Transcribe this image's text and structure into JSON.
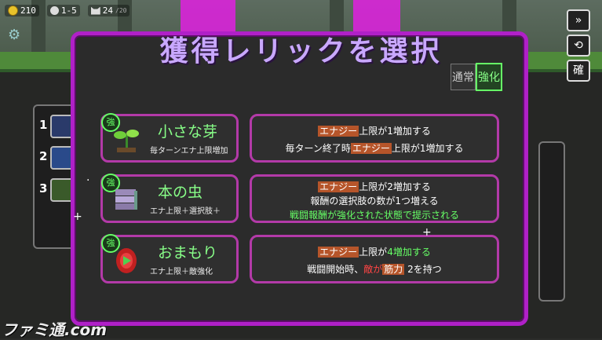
{
  "hud": {
    "gold": "210",
    "floor": "1-5",
    "party": "24",
    "party_unit": "/20"
  },
  "side_buttons": [
    "»",
    "⟲",
    "確"
  ],
  "slots": [
    "1",
    "2",
    "3"
  ],
  "modal": {
    "title": "獲得レリックを選択",
    "toggle_normal": "通常",
    "toggle_strong": "強化"
  },
  "relics": [
    {
      "badge": "強",
      "name": "小さな芽",
      "sub": "毎ターンエナ上限増加",
      "desc": [
        [
          {
            "t": "エナジー",
            "c": "hl"
          },
          {
            "t": "上限が1増加する",
            "c": ""
          }
        ],
        [
          {
            "t": "毎ターン終了時",
            "c": ""
          },
          {
            "t": "エナジー",
            "c": "hl"
          },
          {
            "t": "上限が1増加する",
            "c": ""
          }
        ]
      ]
    },
    {
      "badge": "強",
      "name": "本の虫",
      "sub": "エナ上限＋選択肢＋",
      "desc": [
        [
          {
            "t": "エナジー",
            "c": "hl"
          },
          {
            "t": "上限が2増加する",
            "c": ""
          }
        ],
        [
          {
            "t": "報酬の選択肢の数が1つ増える",
            "c": ""
          }
        ],
        [
          {
            "t": "戦闘報酬が強化された状態で提示される",
            "c": "grn"
          }
        ]
      ]
    },
    {
      "badge": "強",
      "name": "おまもり",
      "sub": "エナ上限＋敵強化",
      "desc": [
        [
          {
            "t": "エナジー",
            "c": "hl"
          },
          {
            "t": "上限が",
            "c": ""
          },
          {
            "t": "4増加する",
            "c": "grn"
          }
        ],
        [
          {
            "t": "戦闘開始時、",
            "c": ""
          },
          {
            "t": "敵が",
            "c": "red"
          },
          {
            "t": "筋力",
            "c": "hl"
          },
          {
            "t": " 2を持つ",
            "c": ""
          }
        ]
      ]
    }
  ],
  "watermark": "ファミ通.com"
}
